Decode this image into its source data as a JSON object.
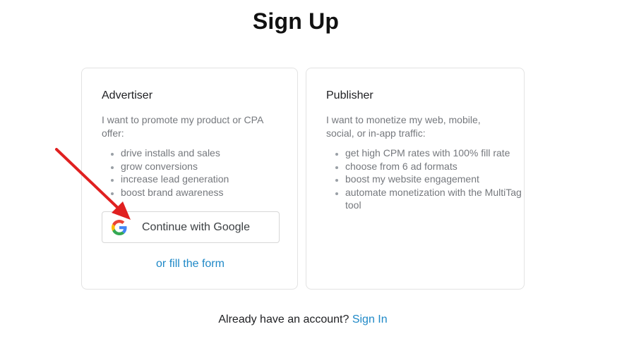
{
  "page": {
    "title": "Sign Up"
  },
  "advertiser": {
    "title": "Advertiser",
    "description": "I want to promote my product or CPA offer:",
    "items": [
      "drive installs and sales",
      "grow conversions",
      "increase lead generation",
      "boost brand awareness"
    ],
    "google_button_label": "Continue with Google",
    "fill_form_link": "or fill the form"
  },
  "publisher": {
    "title": "Publisher",
    "description": "I want to monetize my web, mobile, social, or in-app traffic:",
    "items": [
      "get high CPM rates with 100% fill rate",
      "choose from 6 ad formats",
      "boost my website engagement",
      "automate monetization with the MultiTag tool"
    ]
  },
  "footer": {
    "prompt": "Already have an account?",
    "signin_link": "Sign In"
  },
  "colors": {
    "link": "#1e88c7",
    "annotation_arrow": "#e02020"
  },
  "icons": {
    "google": "google-g-icon",
    "annotation": "red-arrow-annotation"
  }
}
